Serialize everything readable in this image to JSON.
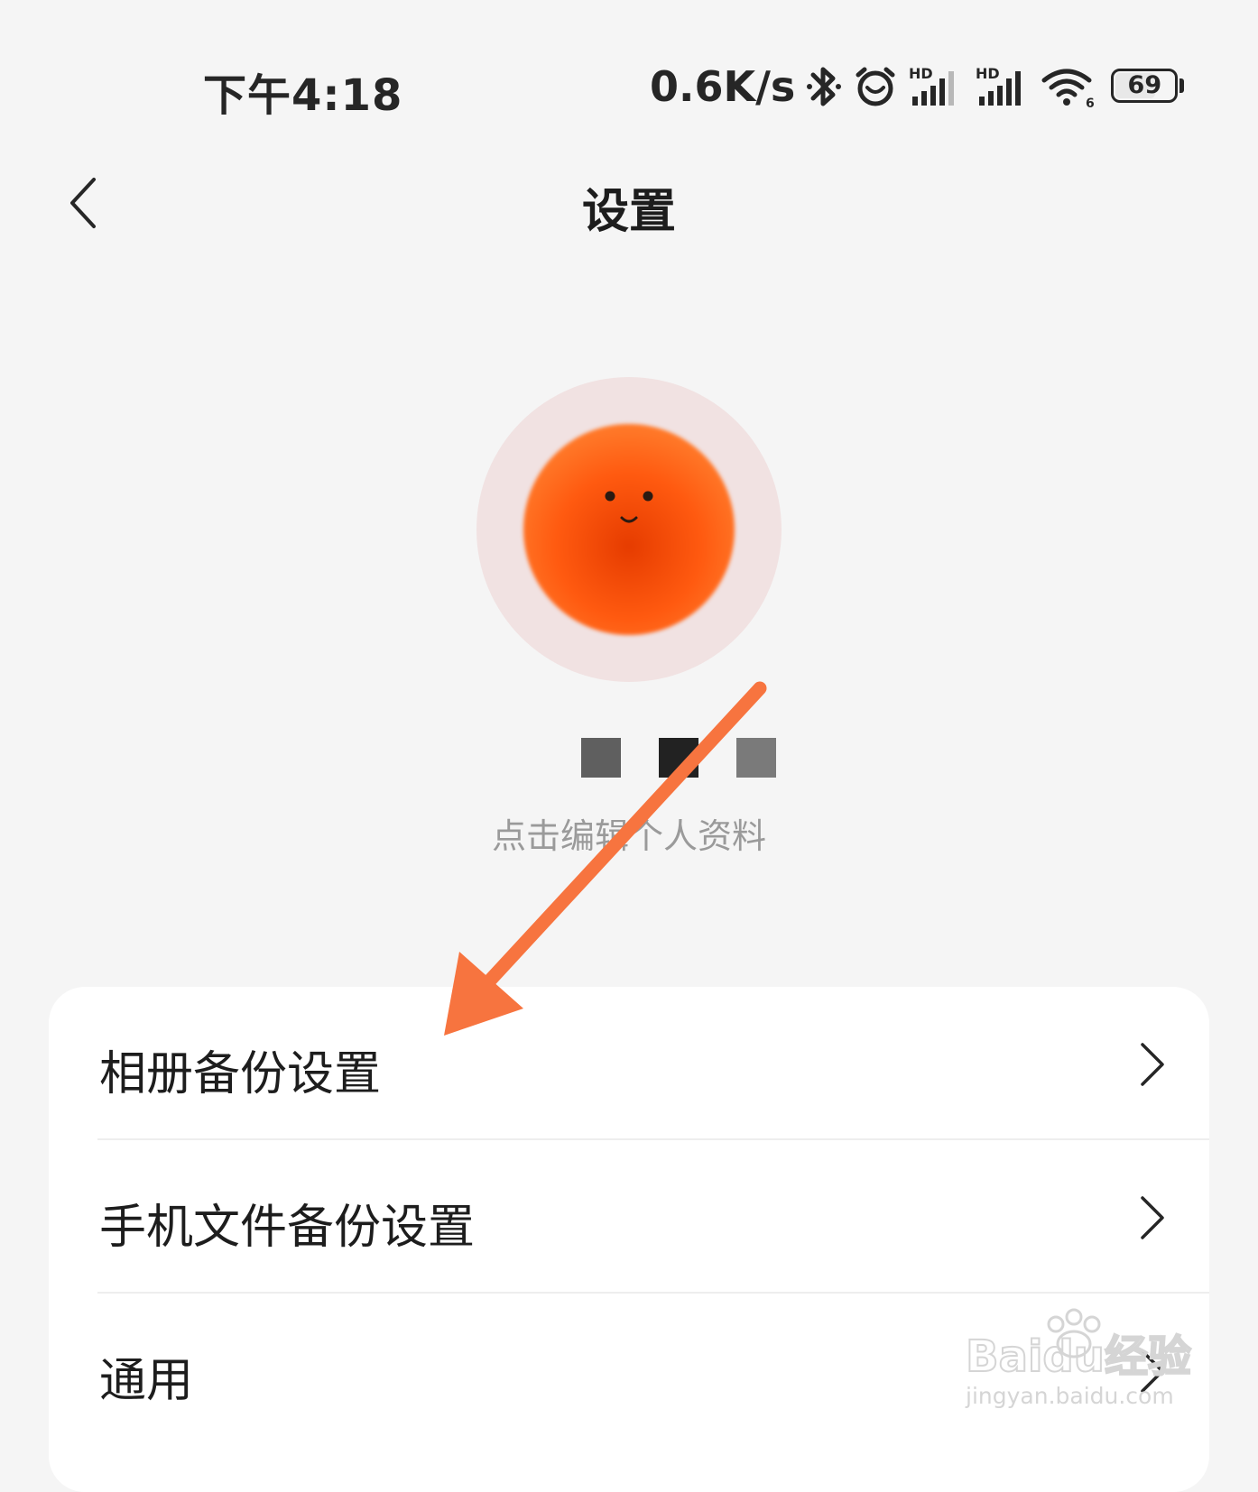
{
  "status_bar": {
    "time": "下午4:18",
    "net_speed": "0.6K/s",
    "battery_level": "69",
    "battery_fraction": 0.69,
    "icons": [
      "bluetooth-icon",
      "alarm-icon",
      "hd-signal-icon",
      "hd-signal-icon",
      "wifi-icon",
      "battery-icon"
    ]
  },
  "nav": {
    "title": "设置",
    "back_icon": "chevron-left-icon"
  },
  "profile": {
    "avatar_description_icon": "smiling-orange-ball-avatar",
    "nickname_blocks": [
      "#5f5f5f",
      "#222222",
      "#7a7a7a"
    ],
    "edit_hint": "点击编辑个人资料"
  },
  "settings": {
    "items": [
      {
        "label": "相册备份设置"
      },
      {
        "label": "手机文件备份设置"
      },
      {
        "label": "通用"
      }
    ]
  },
  "annotation": {
    "arrow_color": "#f7743f"
  },
  "watermark": {
    "brand": "Baidu经验",
    "url": "jingyan.baidu.com"
  }
}
